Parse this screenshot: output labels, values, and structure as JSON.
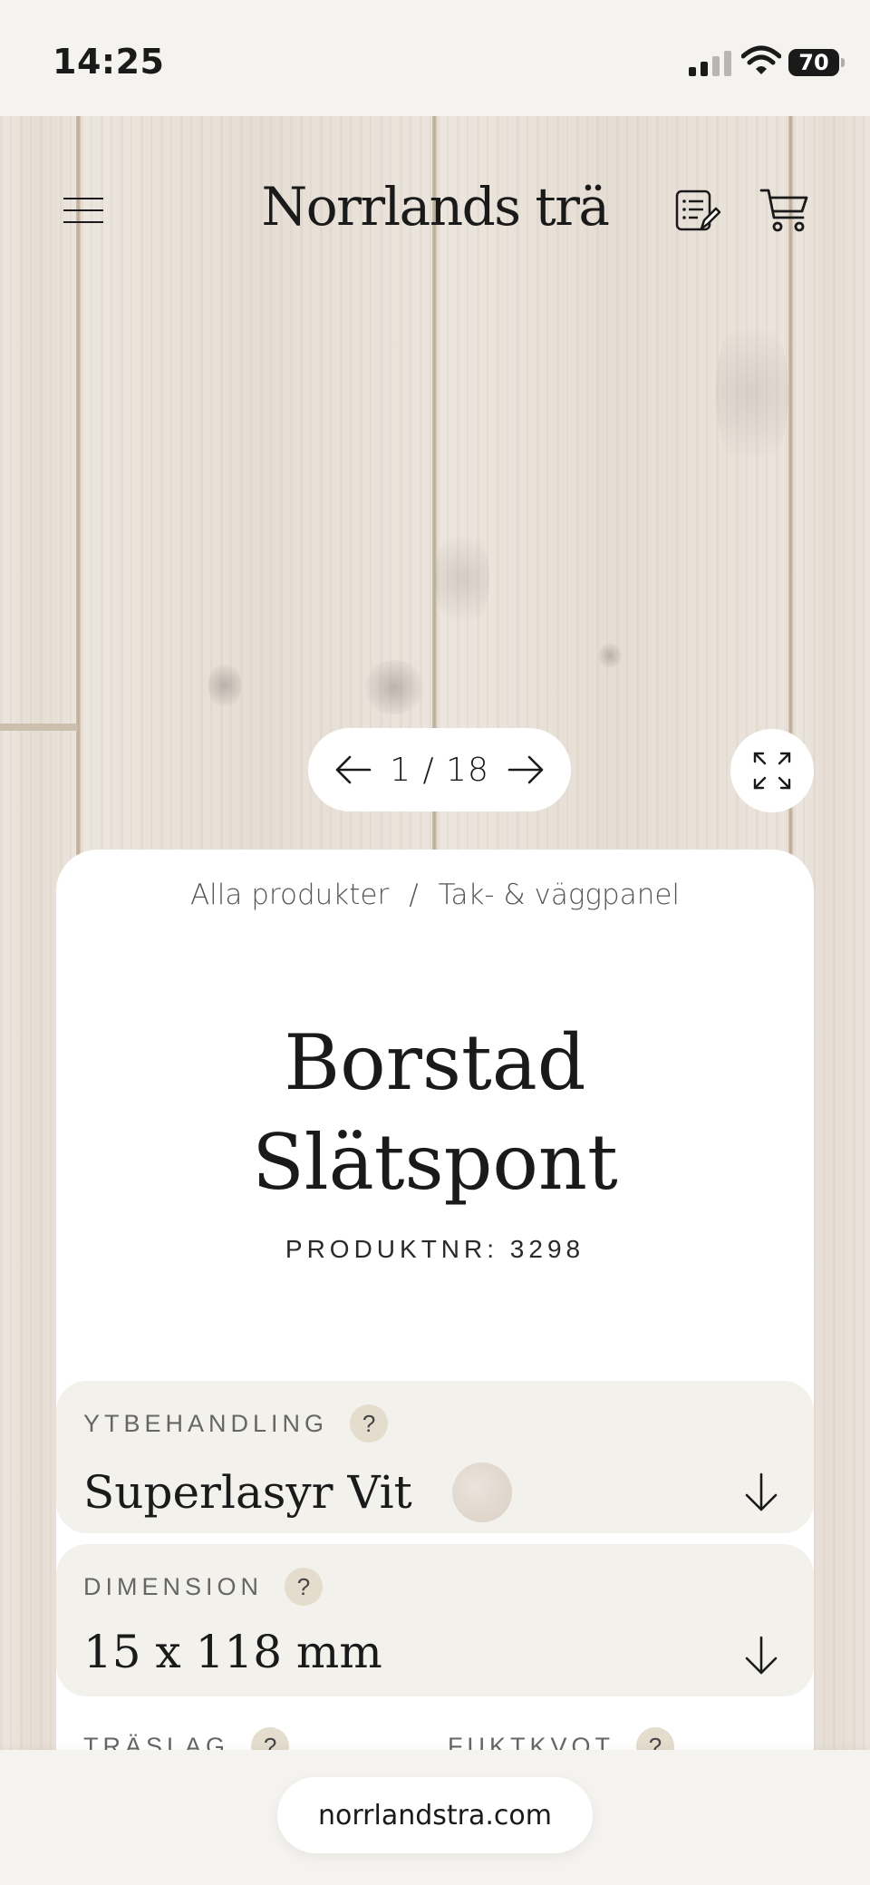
{
  "status_bar": {
    "time": "14:25",
    "battery": "70"
  },
  "header": {
    "logo": "Norrlands trä"
  },
  "carousel": {
    "counter": "1 / 18"
  },
  "breadcrumb": {
    "item1": "Alla produkter",
    "separator": "/",
    "item2": "Tak- & väggpanel"
  },
  "product": {
    "title_line1": "Borstad",
    "title_line2": "Slätspont",
    "product_number": "PRODUKTNR: 3298"
  },
  "options": {
    "finish": {
      "label": "YTBEHANDLING",
      "help": "?",
      "value": "Superlasyr Vit"
    },
    "dimension": {
      "label": "DIMENSION",
      "help": "?",
      "value": "15 x 118 mm"
    },
    "wood_type": {
      "label": "TRÄSLAG",
      "help": "?"
    },
    "moisture": {
      "label": "FUKTKVOT",
      "help": "?"
    }
  },
  "browser": {
    "url": "norrlandstra.com"
  },
  "icons": {
    "menu": "hamburger-menu-icon",
    "quote": "quote-list-icon",
    "cart": "shopping-cart-icon",
    "prev": "arrow-left-icon",
    "next": "arrow-right-icon",
    "expand": "expand-icon",
    "chevron": "arrow-down-icon"
  },
  "colors": {
    "background": "#f4f2ee",
    "card": "#ffffff",
    "field": "#f3f1ec",
    "help_badge": "#e4dccc"
  }
}
